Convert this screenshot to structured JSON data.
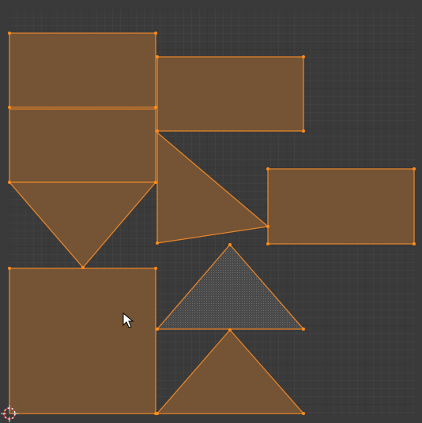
{
  "editor": {
    "name": "uv-editor-viewport",
    "background_color": "#3d3d3d",
    "outer_frame_color": "#303030",
    "grid_fine_color": "#454545",
    "grid_major_color": "#2e2e2e",
    "uv_fill_color": "#7a5734",
    "uv_edge_color": "#f08a24",
    "uv_vertex_color": "#ff8c1a",
    "uv_overlap_color": "#5a5a5a"
  },
  "islands": [
    {
      "name": "uv-island-rect-1",
      "selected": true
    },
    {
      "name": "uv-island-rect-2",
      "selected": true
    },
    {
      "name": "uv-island-rect-3",
      "selected": true
    },
    {
      "name": "uv-island-triangle-1",
      "selected": true
    },
    {
      "name": "uv-island-triangle-2",
      "selected": true
    },
    {
      "name": "uv-island-rect-4",
      "selected": true
    },
    {
      "name": "uv-island-square",
      "selected": true
    },
    {
      "name": "uv-island-triangle-overlap",
      "selected": false
    },
    {
      "name": "uv-island-triangle-bottom",
      "selected": true
    }
  ],
  "cursor": {
    "icon": "mouse-pointer-icon"
  },
  "pivot": {
    "icon": "2d-cursor-icon"
  }
}
